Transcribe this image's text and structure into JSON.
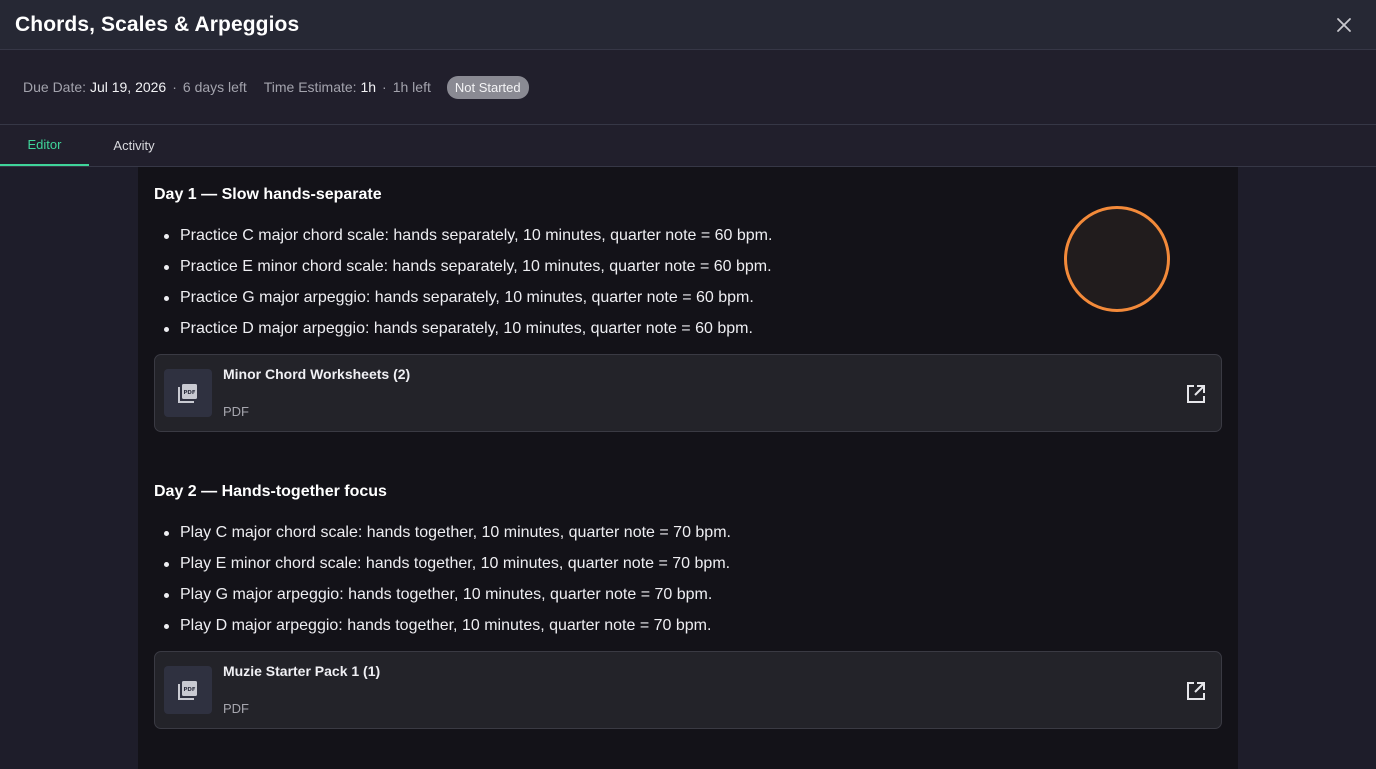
{
  "dialog": {
    "title": "Chords, Scales & Arpeggios"
  },
  "meta": {
    "due_label": "Due Date:",
    "due_value": "Jul 19, 2026",
    "due_sep": "·",
    "due_remaining": "6 days left",
    "estimate_label": "Time Estimate:",
    "estimate_value": "1h",
    "estimate_sep": "·",
    "estimate_remaining": "1h left",
    "status": "Not Started"
  },
  "tabs": [
    {
      "label": "Editor",
      "active": true
    },
    {
      "label": "Activity",
      "active": false
    }
  ],
  "days": [
    {
      "heading": "Day 1 — Slow hands-separate",
      "items": [
        "Practice C major chord scale: hands separately, 10 minutes, quarter note = 60 bpm.",
        "Practice E minor chord scale: hands separately, 10 minutes, quarter note = 60 bpm.",
        "Practice G major arpeggio: hands separately, 10 minutes, quarter note = 60 bpm.",
        "Practice D major arpeggio: hands separately, 10 minutes, quarter note = 60 bpm."
      ],
      "attachment": {
        "name": "Minor Chord Worksheets (2)",
        "type": "PDF",
        "icon": "pdf-icon"
      }
    },
    {
      "heading": "Day 2 — Hands-together focus",
      "items": [
        "Play C major chord scale: hands together, 10 minutes, quarter note = 70 bpm.",
        "Play E minor chord scale: hands together, 10 minutes, quarter note = 70 bpm.",
        "Play G major arpeggio: hands together, 10 minutes, quarter note = 70 bpm.",
        "Play D major arpeggio: hands together, 10 minutes, quarter note = 70 bpm."
      ],
      "attachment": {
        "name": "Muzie Starter Pack 1 (1)",
        "type": "PDF",
        "icon": "pdf-icon"
      }
    }
  ],
  "colors": {
    "accent": "#3fd49a",
    "cursor_ring": "#f38a3a",
    "badge": "#8a8a93"
  },
  "icons": {
    "close": "close-icon",
    "open": "open-external-icon"
  }
}
